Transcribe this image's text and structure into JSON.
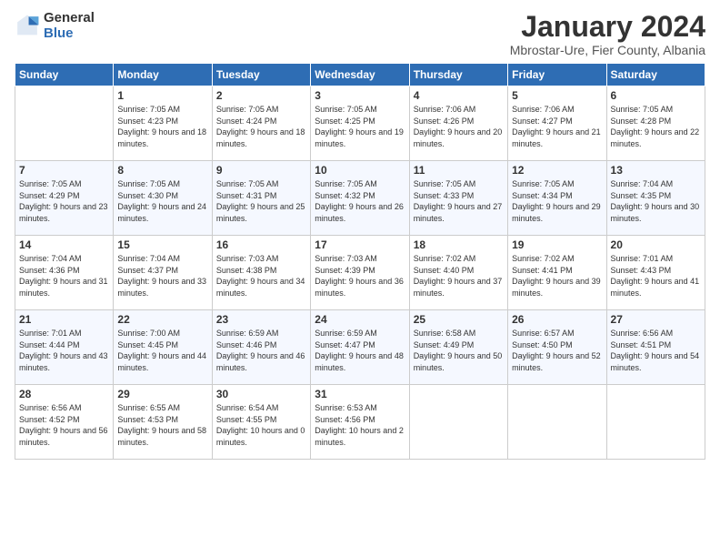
{
  "logo": {
    "general": "General",
    "blue": "Blue"
  },
  "header": {
    "month": "January 2024",
    "location": "Mbrostar-Ure, Fier County, Albania"
  },
  "weekdays": [
    "Sunday",
    "Monday",
    "Tuesday",
    "Wednesday",
    "Thursday",
    "Friday",
    "Saturday"
  ],
  "weeks": [
    [
      {
        "day": "",
        "sunrise": "",
        "sunset": "",
        "daylight": ""
      },
      {
        "day": "1",
        "sunrise": "Sunrise: 7:05 AM",
        "sunset": "Sunset: 4:23 PM",
        "daylight": "Daylight: 9 hours and 18 minutes."
      },
      {
        "day": "2",
        "sunrise": "Sunrise: 7:05 AM",
        "sunset": "Sunset: 4:24 PM",
        "daylight": "Daylight: 9 hours and 18 minutes."
      },
      {
        "day": "3",
        "sunrise": "Sunrise: 7:05 AM",
        "sunset": "Sunset: 4:25 PM",
        "daylight": "Daylight: 9 hours and 19 minutes."
      },
      {
        "day": "4",
        "sunrise": "Sunrise: 7:06 AM",
        "sunset": "Sunset: 4:26 PM",
        "daylight": "Daylight: 9 hours and 20 minutes."
      },
      {
        "day": "5",
        "sunrise": "Sunrise: 7:06 AM",
        "sunset": "Sunset: 4:27 PM",
        "daylight": "Daylight: 9 hours and 21 minutes."
      },
      {
        "day": "6",
        "sunrise": "Sunrise: 7:05 AM",
        "sunset": "Sunset: 4:28 PM",
        "daylight": "Daylight: 9 hours and 22 minutes."
      }
    ],
    [
      {
        "day": "7",
        "sunrise": "Sunrise: 7:05 AM",
        "sunset": "Sunset: 4:29 PM",
        "daylight": "Daylight: 9 hours and 23 minutes."
      },
      {
        "day": "8",
        "sunrise": "Sunrise: 7:05 AM",
        "sunset": "Sunset: 4:30 PM",
        "daylight": "Daylight: 9 hours and 24 minutes."
      },
      {
        "day": "9",
        "sunrise": "Sunrise: 7:05 AM",
        "sunset": "Sunset: 4:31 PM",
        "daylight": "Daylight: 9 hours and 25 minutes."
      },
      {
        "day": "10",
        "sunrise": "Sunrise: 7:05 AM",
        "sunset": "Sunset: 4:32 PM",
        "daylight": "Daylight: 9 hours and 26 minutes."
      },
      {
        "day": "11",
        "sunrise": "Sunrise: 7:05 AM",
        "sunset": "Sunset: 4:33 PM",
        "daylight": "Daylight: 9 hours and 27 minutes."
      },
      {
        "day": "12",
        "sunrise": "Sunrise: 7:05 AM",
        "sunset": "Sunset: 4:34 PM",
        "daylight": "Daylight: 9 hours and 29 minutes."
      },
      {
        "day": "13",
        "sunrise": "Sunrise: 7:04 AM",
        "sunset": "Sunset: 4:35 PM",
        "daylight": "Daylight: 9 hours and 30 minutes."
      }
    ],
    [
      {
        "day": "14",
        "sunrise": "Sunrise: 7:04 AM",
        "sunset": "Sunset: 4:36 PM",
        "daylight": "Daylight: 9 hours and 31 minutes."
      },
      {
        "day": "15",
        "sunrise": "Sunrise: 7:04 AM",
        "sunset": "Sunset: 4:37 PM",
        "daylight": "Daylight: 9 hours and 33 minutes."
      },
      {
        "day": "16",
        "sunrise": "Sunrise: 7:03 AM",
        "sunset": "Sunset: 4:38 PM",
        "daylight": "Daylight: 9 hours and 34 minutes."
      },
      {
        "day": "17",
        "sunrise": "Sunrise: 7:03 AM",
        "sunset": "Sunset: 4:39 PM",
        "daylight": "Daylight: 9 hours and 36 minutes."
      },
      {
        "day": "18",
        "sunrise": "Sunrise: 7:02 AM",
        "sunset": "Sunset: 4:40 PM",
        "daylight": "Daylight: 9 hours and 37 minutes."
      },
      {
        "day": "19",
        "sunrise": "Sunrise: 7:02 AM",
        "sunset": "Sunset: 4:41 PM",
        "daylight": "Daylight: 9 hours and 39 minutes."
      },
      {
        "day": "20",
        "sunrise": "Sunrise: 7:01 AM",
        "sunset": "Sunset: 4:43 PM",
        "daylight": "Daylight: 9 hours and 41 minutes."
      }
    ],
    [
      {
        "day": "21",
        "sunrise": "Sunrise: 7:01 AM",
        "sunset": "Sunset: 4:44 PM",
        "daylight": "Daylight: 9 hours and 43 minutes."
      },
      {
        "day": "22",
        "sunrise": "Sunrise: 7:00 AM",
        "sunset": "Sunset: 4:45 PM",
        "daylight": "Daylight: 9 hours and 44 minutes."
      },
      {
        "day": "23",
        "sunrise": "Sunrise: 6:59 AM",
        "sunset": "Sunset: 4:46 PM",
        "daylight": "Daylight: 9 hours and 46 minutes."
      },
      {
        "day": "24",
        "sunrise": "Sunrise: 6:59 AM",
        "sunset": "Sunset: 4:47 PM",
        "daylight": "Daylight: 9 hours and 48 minutes."
      },
      {
        "day": "25",
        "sunrise": "Sunrise: 6:58 AM",
        "sunset": "Sunset: 4:49 PM",
        "daylight": "Daylight: 9 hours and 50 minutes."
      },
      {
        "day": "26",
        "sunrise": "Sunrise: 6:57 AM",
        "sunset": "Sunset: 4:50 PM",
        "daylight": "Daylight: 9 hours and 52 minutes."
      },
      {
        "day": "27",
        "sunrise": "Sunrise: 6:56 AM",
        "sunset": "Sunset: 4:51 PM",
        "daylight": "Daylight: 9 hours and 54 minutes."
      }
    ],
    [
      {
        "day": "28",
        "sunrise": "Sunrise: 6:56 AM",
        "sunset": "Sunset: 4:52 PM",
        "daylight": "Daylight: 9 hours and 56 minutes."
      },
      {
        "day": "29",
        "sunrise": "Sunrise: 6:55 AM",
        "sunset": "Sunset: 4:53 PM",
        "daylight": "Daylight: 9 hours and 58 minutes."
      },
      {
        "day": "30",
        "sunrise": "Sunrise: 6:54 AM",
        "sunset": "Sunset: 4:55 PM",
        "daylight": "Daylight: 10 hours and 0 minutes."
      },
      {
        "day": "31",
        "sunrise": "Sunrise: 6:53 AM",
        "sunset": "Sunset: 4:56 PM",
        "daylight": "Daylight: 10 hours and 2 minutes."
      },
      {
        "day": "",
        "sunrise": "",
        "sunset": "",
        "daylight": ""
      },
      {
        "day": "",
        "sunrise": "",
        "sunset": "",
        "daylight": ""
      },
      {
        "day": "",
        "sunrise": "",
        "sunset": "",
        "daylight": ""
      }
    ]
  ]
}
